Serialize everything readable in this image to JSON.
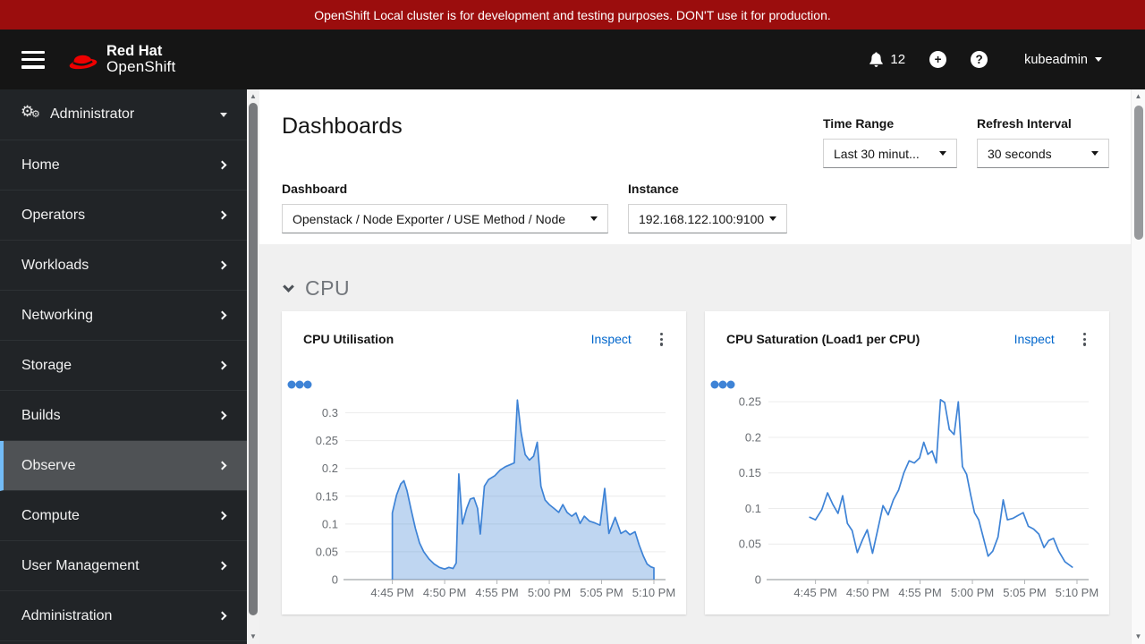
{
  "banner": {
    "text": "OpenShift Local cluster is for development and testing purposes. DON'T use it for production."
  },
  "masthead": {
    "brand_line1": "Red Hat",
    "brand_line2": "OpenShift",
    "notifications_count": "12",
    "username": "kubeadmin"
  },
  "sidebar": {
    "perspective": "Administrator",
    "items": [
      "Home",
      "Operators",
      "Workloads",
      "Networking",
      "Storage",
      "Builds",
      "Observe",
      "Compute",
      "User Management",
      "Administration"
    ],
    "active": "Observe"
  },
  "page": {
    "title": "Dashboards",
    "filters": {
      "dashboard_label": "Dashboard",
      "dashboard_value": "Openstack / Node Exporter / USE Method / Node",
      "instance_label": "Instance",
      "instance_value": "192.168.122.100:9100",
      "time_range_label": "Time Range",
      "time_range_value": "Last 30 minut...",
      "refresh_label": "Refresh Interval",
      "refresh_value": "30 seconds"
    },
    "section_title": "CPU"
  },
  "cards": [
    {
      "title": "CPU Utilisation",
      "action": "Inspect"
    },
    {
      "title": "CPU Saturation (Load1 per CPU)",
      "action": "Inspect"
    }
  ],
  "icons": {
    "menu": "hamburger-icon",
    "notifications": "bell-icon",
    "add": "plus-circle-icon",
    "help": "question-circle-icon",
    "perspective": "cogs-icon",
    "nav_expand": "chevron-right-icon",
    "section_toggle": "chevron-down-icon",
    "dropdown": "caret-down-icon",
    "card_menu": "kebab-icon",
    "series_legend": "legend-dots-icon"
  },
  "colors": {
    "banner_bg": "#9b0d0d",
    "masthead_bg": "#151515",
    "sidebar_bg": "#212427",
    "sidebar_active_border": "#73bcf7",
    "link": "#0066cc",
    "chart_stroke": "#3e83d6",
    "chart_fill": "rgba(62,131,214,0.33)",
    "body_bg": "#f0f0f0"
  },
  "chart_data": [
    {
      "type": "area",
      "title": "CPU Utilisation",
      "x_unit": "minutes after 4:45 PM",
      "xlim": [
        -4.5,
        25.6
      ],
      "ylim": [
        0,
        0.325
      ],
      "grid": true,
      "x_ticks": [
        {
          "t": 0,
          "label": "4:45 PM"
        },
        {
          "t": 5,
          "label": "4:50 PM"
        },
        {
          "t": 10,
          "label": "4:55 PM"
        },
        {
          "t": 15,
          "label": "5:00 PM"
        },
        {
          "t": 20,
          "label": "5:05 PM"
        },
        {
          "t": 25,
          "label": "5:10 PM"
        }
      ],
      "y_ticks": [
        {
          "v": 0,
          "label": "0"
        },
        {
          "v": 0.05,
          "label": "0.05"
        },
        {
          "v": 0.1,
          "label": "0.1"
        },
        {
          "v": 0.15,
          "label": "0.15"
        },
        {
          "v": 0.2,
          "label": "0.2"
        },
        {
          "v": 0.25,
          "label": "0.25"
        },
        {
          "v": 0.3,
          "label": "0.3"
        }
      ],
      "points": [
        [
          0,
          0.12
        ],
        [
          0.4,
          0.152
        ],
        [
          0.8,
          0.172
        ],
        [
          1.1,
          0.178
        ],
        [
          1.4,
          0.16
        ],
        [
          1.8,
          0.125
        ],
        [
          2.2,
          0.092
        ],
        [
          2.6,
          0.066
        ],
        [
          3,
          0.05
        ],
        [
          3.5,
          0.037
        ],
        [
          4,
          0.028
        ],
        [
          4.5,
          0.022
        ],
        [
          5,
          0.019
        ],
        [
          5.4,
          0.022
        ],
        [
          5.8,
          0.02
        ],
        [
          6.1,
          0.03
        ],
        [
          6.35,
          0.19
        ],
        [
          6.7,
          0.1
        ],
        [
          7.1,
          0.128
        ],
        [
          7.45,
          0.145
        ],
        [
          7.8,
          0.147
        ],
        [
          8.15,
          0.128
        ],
        [
          8.4,
          0.082
        ],
        [
          8.8,
          0.168
        ],
        [
          9.2,
          0.18
        ],
        [
          9.8,
          0.187
        ],
        [
          10.3,
          0.197
        ],
        [
          10.8,
          0.203
        ],
        [
          11.3,
          0.207
        ],
        [
          11.65,
          0.21
        ],
        [
          11.95,
          0.323
        ],
        [
          12.3,
          0.265
        ],
        [
          12.7,
          0.225
        ],
        [
          13.1,
          0.215
        ],
        [
          13.5,
          0.222
        ],
        [
          13.85,
          0.247
        ],
        [
          14.2,
          0.168
        ],
        [
          14.6,
          0.143
        ],
        [
          15,
          0.135
        ],
        [
          15.45,
          0.128
        ],
        [
          15.9,
          0.121
        ],
        [
          16.3,
          0.135
        ],
        [
          16.7,
          0.121
        ],
        [
          17.15,
          0.114
        ],
        [
          17.55,
          0.12
        ],
        [
          17.95,
          0.101
        ],
        [
          18.35,
          0.114
        ],
        [
          18.85,
          0.105
        ],
        [
          19.35,
          0.102
        ],
        [
          19.85,
          0.098
        ],
        [
          20.3,
          0.164
        ],
        [
          20.7,
          0.083
        ],
        [
          21.3,
          0.112
        ],
        [
          21.85,
          0.083
        ],
        [
          22.3,
          0.088
        ],
        [
          22.7,
          0.081
        ],
        [
          23.2,
          0.086
        ],
        [
          23.6,
          0.062
        ],
        [
          24,
          0.042
        ],
        [
          24.35,
          0.028
        ],
        [
          24.7,
          0.023
        ],
        [
          25,
          0.021
        ]
      ]
    },
    {
      "type": "line",
      "title": "CPU Saturation (Load1 per CPU)",
      "x_unit": "minutes after 4:45 PM",
      "xlim": [
        -4.5,
        25.6
      ],
      "ylim": [
        0,
        0.254
      ],
      "grid": true,
      "x_ticks": [
        {
          "t": 0,
          "label": "4:45 PM"
        },
        {
          "t": 5,
          "label": "4:50 PM"
        },
        {
          "t": 10,
          "label": "4:55 PM"
        },
        {
          "t": 15,
          "label": "5:00 PM"
        },
        {
          "t": 20,
          "label": "5:05 PM"
        },
        {
          "t": 25,
          "label": "5:10 PM"
        }
      ],
      "y_ticks": [
        {
          "v": 0,
          "label": "0"
        },
        {
          "v": 0.05,
          "label": "0.05"
        },
        {
          "v": 0.1,
          "label": "0.1"
        },
        {
          "v": 0.15,
          "label": "0.15"
        },
        {
          "v": 0.2,
          "label": "0.2"
        },
        {
          "v": 0.25,
          "label": "0.25"
        }
      ],
      "points": [
        [
          -0.6,
          0.088
        ],
        [
          0,
          0.084
        ],
        [
          0.6,
          0.098
        ],
        [
          1.15,
          0.122
        ],
        [
          1.65,
          0.106
        ],
        [
          2.15,
          0.093
        ],
        [
          2.6,
          0.118
        ],
        [
          3.05,
          0.079
        ],
        [
          3.5,
          0.069
        ],
        [
          4,
          0.038
        ],
        [
          4.5,
          0.056
        ],
        [
          4.95,
          0.07
        ],
        [
          5.45,
          0.037
        ],
        [
          5.95,
          0.07
        ],
        [
          6.45,
          0.104
        ],
        [
          6.95,
          0.091
        ],
        [
          7.45,
          0.112
        ],
        [
          7.95,
          0.126
        ],
        [
          8.45,
          0.15
        ],
        [
          8.95,
          0.167
        ],
        [
          9.45,
          0.164
        ],
        [
          9.95,
          0.171
        ],
        [
          10.35,
          0.193
        ],
        [
          10.75,
          0.176
        ],
        [
          11.15,
          0.181
        ],
        [
          11.55,
          0.164
        ],
        [
          11.95,
          0.253
        ],
        [
          12.35,
          0.249
        ],
        [
          12.8,
          0.211
        ],
        [
          13.25,
          0.204
        ],
        [
          13.65,
          0.25
        ],
        [
          14.05,
          0.159
        ],
        [
          14.45,
          0.148
        ],
        [
          14.85,
          0.118
        ],
        [
          15.2,
          0.094
        ],
        [
          15.6,
          0.084
        ],
        [
          16.05,
          0.059
        ],
        [
          16.5,
          0.033
        ],
        [
          16.95,
          0.04
        ],
        [
          17.45,
          0.06
        ],
        [
          17.95,
          0.112
        ],
        [
          18.35,
          0.084
        ],
        [
          18.85,
          0.086
        ],
        [
          19.35,
          0.09
        ],
        [
          19.85,
          0.094
        ],
        [
          20.35,
          0.075
        ],
        [
          20.85,
          0.071
        ],
        [
          21.35,
          0.064
        ],
        [
          21.85,
          0.045
        ],
        [
          22.3,
          0.055
        ],
        [
          22.75,
          0.058
        ],
        [
          23.25,
          0.04
        ],
        [
          23.85,
          0.025
        ],
        [
          24.6,
          0.017
        ]
      ]
    }
  ]
}
